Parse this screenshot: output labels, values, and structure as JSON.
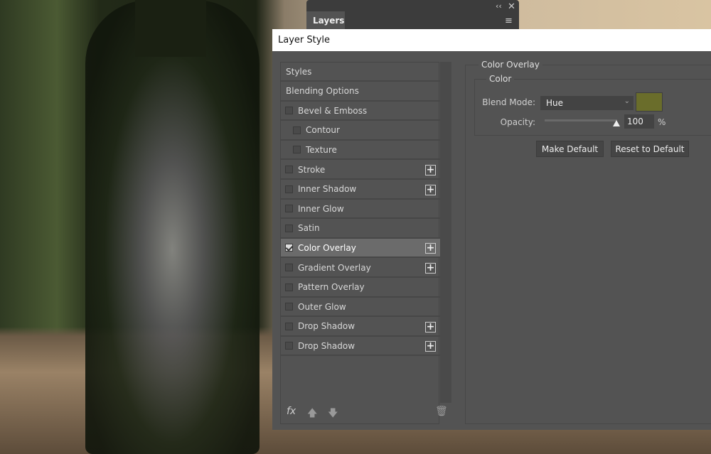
{
  "layers_panel": {
    "tab": "Layers",
    "collapse_icon": "double-chevron-left",
    "close_icon": "close",
    "menu_icon": "hamburger"
  },
  "dialog": {
    "title": "Layer Style",
    "styles_list": [
      {
        "label": "Styles",
        "checkbox": false
      },
      {
        "label": "Blending Options",
        "checkbox": false
      },
      {
        "label": "Bevel & Emboss",
        "checkbox": true,
        "checked": false
      },
      {
        "label": "Contour",
        "checkbox": true,
        "checked": false,
        "indent": true
      },
      {
        "label": "Texture",
        "checkbox": true,
        "checked": false,
        "indent": true
      },
      {
        "label": "Stroke",
        "checkbox": true,
        "checked": false,
        "plus": true
      },
      {
        "label": "Inner Shadow",
        "checkbox": true,
        "checked": false,
        "plus": true
      },
      {
        "label": "Inner Glow",
        "checkbox": true,
        "checked": false
      },
      {
        "label": "Satin",
        "checkbox": true,
        "checked": false
      },
      {
        "label": "Color Overlay",
        "checkbox": true,
        "checked": true,
        "plus": true,
        "selected": true
      },
      {
        "label": "Gradient Overlay",
        "checkbox": true,
        "checked": false,
        "plus": true
      },
      {
        "label": "Pattern Overlay",
        "checkbox": true,
        "checked": false
      },
      {
        "label": "Outer Glow",
        "checkbox": true,
        "checked": false
      },
      {
        "label": "Drop Shadow",
        "checkbox": true,
        "checked": false,
        "plus": true
      },
      {
        "label": "Drop Shadow",
        "checkbox": true,
        "checked": false,
        "plus": true
      }
    ],
    "footer": {
      "fx_label": "fx",
      "up_icon": "arrow-up",
      "down_icon": "arrow-down",
      "trash_icon": "trash"
    },
    "color_overlay": {
      "section_title": "Color Overlay",
      "group_title": "Color",
      "blend_mode_label": "Blend Mode:",
      "blend_mode": "Hue",
      "color": "#6a6d2b",
      "opacity_label": "Opacity:",
      "opacity": "100",
      "opacity_unit": "%",
      "make_default": "Make Default",
      "reset_default": "Reset to Default"
    }
  }
}
